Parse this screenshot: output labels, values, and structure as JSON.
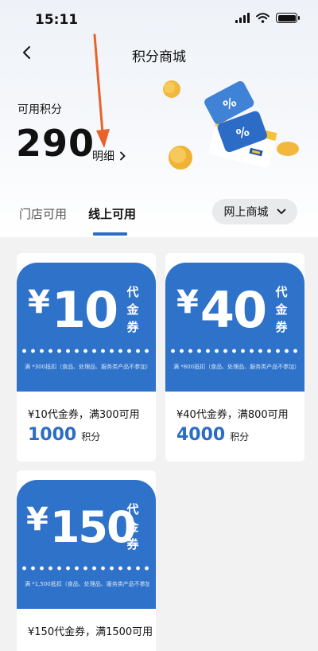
{
  "status_bar": {
    "time": "15:11"
  },
  "nav": {
    "title": "积分商城"
  },
  "points": {
    "label": "可用积分",
    "value": "290",
    "detail_label": "明细"
  },
  "tabs": [
    {
      "label": "门店可用",
      "active": false
    },
    {
      "label": "线上可用",
      "active": true
    }
  ],
  "filter": {
    "selected": "网上商城"
  },
  "colors": {
    "accent": "#2b6cc4",
    "coupon_bg": "#2f72c9",
    "annotation_arrow": "#e8622a"
  },
  "icons": [
    "back-chevron-icon",
    "signal-icon",
    "wifi-icon",
    "battery-icon",
    "chevron-right-icon",
    "chevron-down-icon"
  ],
  "coupons": [
    {
      "currency": "¥",
      "amount": "10",
      "kind": "代金券",
      "note": "满 *300抵扣（食品、处理品、服务类产品不参加）",
      "name": "¥10代金券，满300可用",
      "points": "1000",
      "points_unit": "积分"
    },
    {
      "currency": "¥",
      "amount": "40",
      "kind": "代金券",
      "note": "满 *800抵扣（食品、处理品、服务类产品不参加）",
      "name": "¥40代金券，满800可用",
      "points": "4000",
      "points_unit": "积分"
    },
    {
      "currency": "¥",
      "amount": "150",
      "kind": "代金券",
      "note": "满 *1,500抵扣（食品、处理品、服务类产品不参加）",
      "name": "¥150代金券，满1500可用",
      "points": "",
      "points_unit": ""
    }
  ]
}
